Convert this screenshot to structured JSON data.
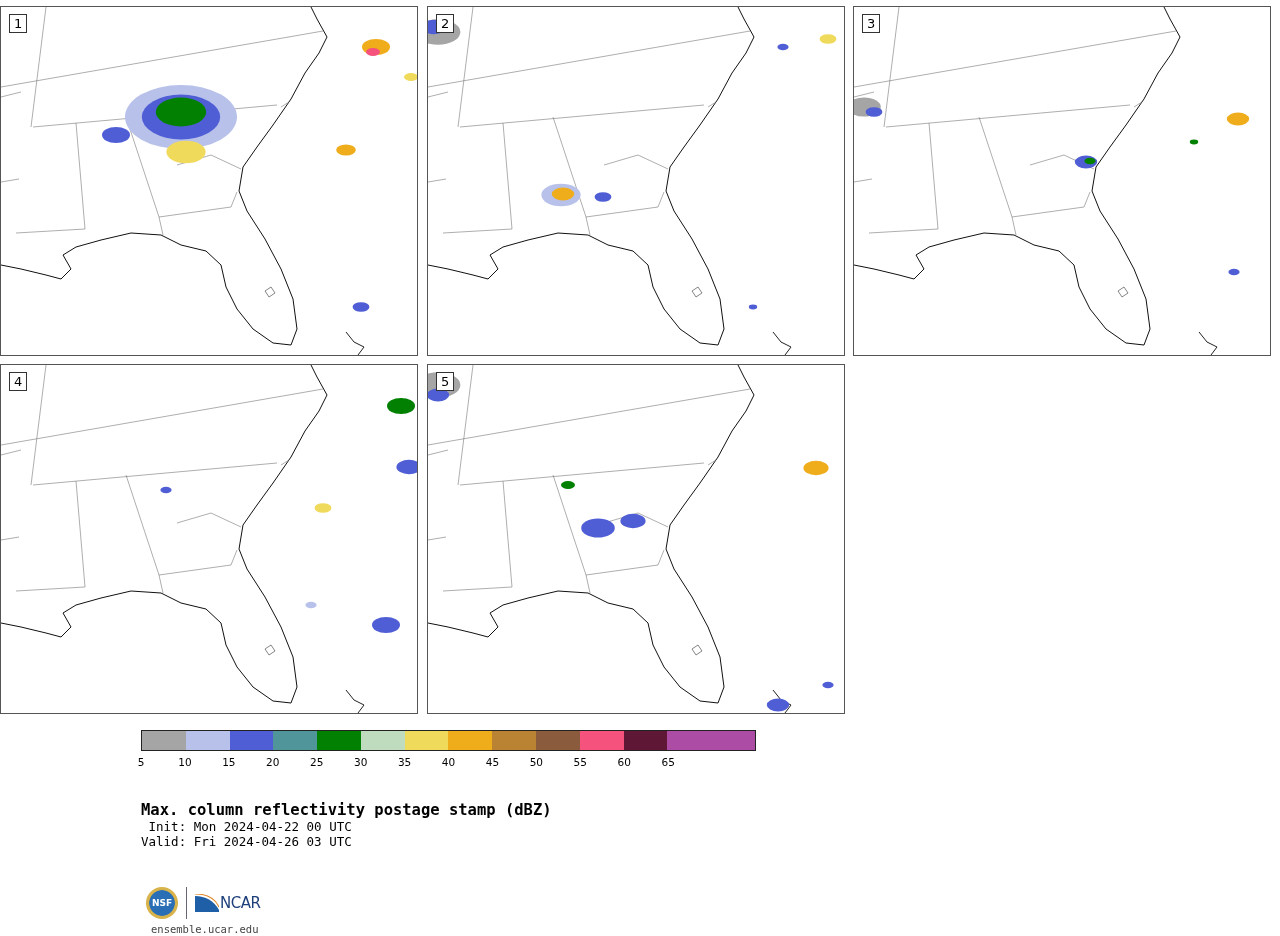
{
  "panels": [
    {
      "number": "1"
    },
    {
      "number": "2"
    },
    {
      "number": "3"
    },
    {
      "number": "4"
    },
    {
      "number": "5"
    }
  ],
  "colorbar": {
    "segments": [
      {
        "color": "#a5a5a5"
      },
      {
        "color": "#b7c1ea"
      },
      {
        "color": "#505ed6"
      },
      {
        "color": "#4f9599"
      },
      {
        "color": "#018001"
      },
      {
        "color": "#bfdcbe"
      },
      {
        "color": "#f0da5c"
      },
      {
        "color": "#efac1b"
      },
      {
        "color": "#b98333"
      },
      {
        "color": "#8b5b3e"
      },
      {
        "color": "#f5537d"
      },
      {
        "color": "#5e1735"
      },
      {
        "color": "#ad4ca5"
      },
      {
        "color": "#ad4ca5"
      }
    ],
    "ticks": [
      "5",
      "10",
      "15",
      "20",
      "25",
      "30",
      "35",
      "40",
      "45",
      "50",
      "55",
      "60",
      "65"
    ]
  },
  "title": "Max. column reflectivity postage stamp (dBZ)",
  "init": " Init: Mon 2024-04-22 00 UTC",
  "valid": "Valid: Fri 2024-04-26 03 UTC",
  "logo": {
    "seal": "NSF",
    "wordmark": "NCAR"
  },
  "url": "ensemble.ucar.edu"
}
